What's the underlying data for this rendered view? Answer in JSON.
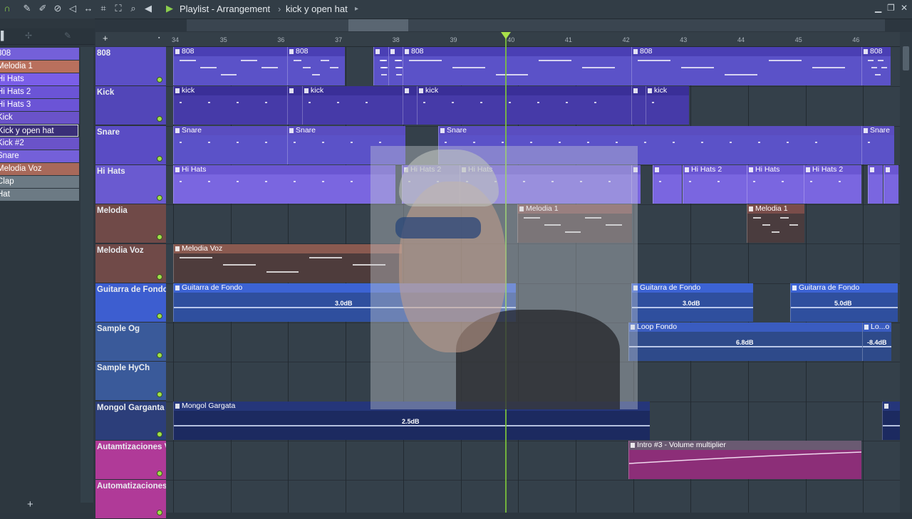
{
  "toolbar": {
    "title": "Playlist - Arrangement",
    "separator": "›",
    "pattern": "kick y open hat",
    "pattern_arrow": "▸"
  },
  "ruler": {
    "bars": [
      "34",
      "35",
      "36",
      "37",
      "38",
      "39",
      "40",
      "41",
      "42",
      "43",
      "44",
      "45",
      "46"
    ]
  },
  "browser": {
    "items": [
      {
        "label": "808",
        "color": "#7460d9"
      },
      {
        "label": "Melodia 1",
        "color": "#b9705d"
      },
      {
        "label": "Hi Hats",
        "color": "#7a5ee8"
      },
      {
        "label": "Hi Hats 2",
        "color": "#6b54d6"
      },
      {
        "label": "Hi Hats 3",
        "color": "#6b54d6"
      },
      {
        "label": "Kick",
        "color": "#6a53c9"
      },
      {
        "label": "Kick y open hat",
        "color": "#3a2f78"
      },
      {
        "label": "Kick #2",
        "color": "#6a53c9"
      },
      {
        "label": "Snare",
        "color": "#7460d9"
      },
      {
        "label": "Melodia Voz",
        "color": "#a8695a"
      },
      {
        "label": "Clap",
        "color": "#6c7a84"
      },
      {
        "label": "Hat",
        "color": "#6c7a84"
      }
    ],
    "add_label": "+"
  },
  "tracks": [
    {
      "name": "808",
      "color": "#5b4fc6"
    },
    {
      "name": "Kick",
      "color": "#5246b8"
    },
    {
      "name": "Snare",
      "color": "#5a4cc4"
    },
    {
      "name": "Hi Hats",
      "color": "#6a5ad0"
    },
    {
      "name": "Melodia",
      "color": "#704a48"
    },
    {
      "name": "Melodia Voz",
      "color": "#704a48"
    },
    {
      "name": "Guitarra de Fondo",
      "color": "#3d5ed0"
    },
    {
      "name": "Sample Og",
      "color": "#3a5a9a"
    },
    {
      "name": "Sample HyCh",
      "color": "#3a5a9a"
    },
    {
      "name": "Mongol Garganta",
      "color": "#2c3e7a"
    },
    {
      "name": "Autamtizaciones Vol",
      "color": "#b03a98"
    },
    {
      "name": "Automatizaciones",
      "color": "#b03a98"
    }
  ],
  "clips": {
    "c808": [
      {
        "label": "808"
      },
      {
        "label": "808"
      },
      {
        "label": ""
      },
      {
        "label": ""
      },
      {
        "label": "808"
      },
      {
        "label": "808"
      },
      {
        "label": "808"
      }
    ],
    "kick": [
      {
        "label": "kick"
      },
      {
        "label": ""
      },
      {
        "label": "kick"
      },
      {
        "label": ""
      },
      {
        "label": "kick"
      },
      {
        "label": ""
      },
      {
        "label": "kick"
      }
    ],
    "snare": [
      {
        "label": "Snare"
      },
      {
        "label": "Snare"
      },
      {
        "label": "Snare"
      },
      {
        "label": "Snare"
      }
    ],
    "hihats": [
      {
        "label": "Hi Hats"
      },
      {
        "label": "Hi Hats 2"
      },
      {
        "label": "Hi Hats"
      },
      {
        "label": ""
      },
      {
        "label": ""
      },
      {
        "label": "Hi Hats 2"
      },
      {
        "label": "Hi Hats"
      },
      {
        "label": "Hi Hats 2"
      },
      {
        "label": ""
      },
      {
        "label": ""
      }
    ],
    "melodia": [
      {
        "label": "Melodia 1"
      },
      {
        "label": "Melodia 1"
      }
    ],
    "melodia_voz": [
      {
        "label": "Melodia Voz"
      }
    ],
    "guitarra": [
      {
        "label": "Guitarra de Fondo",
        "db": "3.0dB"
      },
      {
        "label": "Guitarra de Fondo",
        "db": "3.0dB"
      },
      {
        "label": "Guitarra de Fondo",
        "db": "5.0dB"
      }
    ],
    "sample_og": [
      {
        "label": "Loop Fondo",
        "db": "6.8dB"
      },
      {
        "label": "Lo...o",
        "db": "-8.4dB"
      }
    ],
    "mongol": [
      {
        "label": "Mongol Gargata",
        "db": "2.5dB"
      },
      {
        "label": ""
      }
    ],
    "automation": [
      {
        "label": "Intro #3 - Volume multiplier"
      }
    ]
  }
}
